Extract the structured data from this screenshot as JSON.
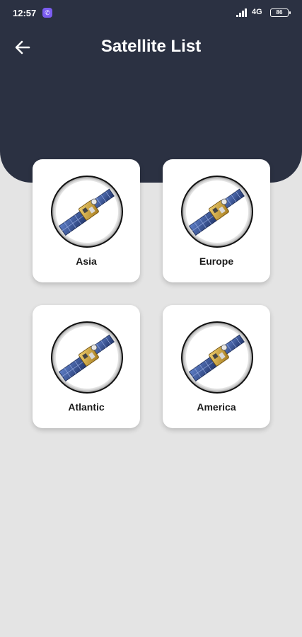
{
  "status_bar": {
    "time": "12:57",
    "network": "4G",
    "battery": "86"
  },
  "header": {
    "title": "Satellite List",
    "background_color": "#2b3142"
  },
  "icons": {
    "back": "arrow-left-icon",
    "notification": "viber-icon",
    "card_image": "satellite-icon"
  },
  "regions": [
    {
      "label": "Asia"
    },
    {
      "label": "Europe"
    },
    {
      "label": "Atlantic"
    },
    {
      "label": "America"
    }
  ]
}
